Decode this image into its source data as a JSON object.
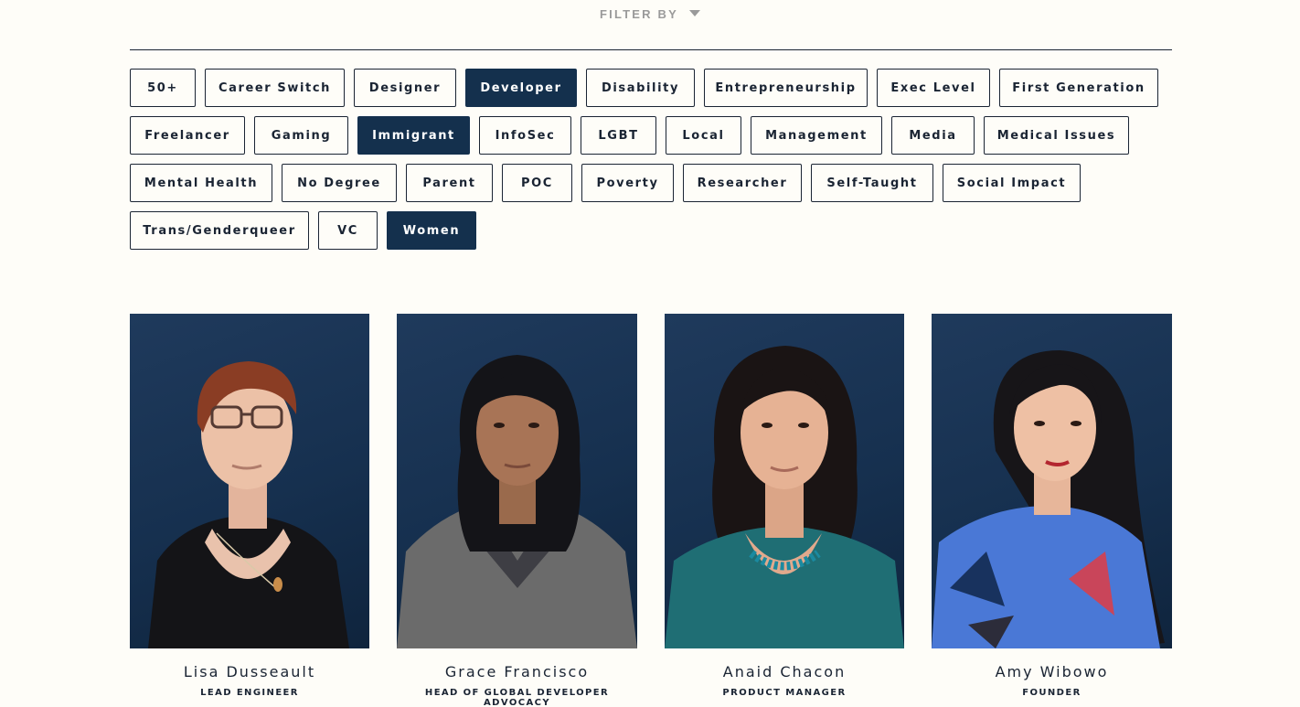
{
  "filter": {
    "label": "FILTER BY"
  },
  "tags": {
    "rows": [
      [
        {
          "label": "50+",
          "active": false
        },
        {
          "label": "Career Switch",
          "active": false
        },
        {
          "label": "Designer",
          "active": false
        },
        {
          "label": "Developer",
          "active": true
        },
        {
          "label": "Disability",
          "active": false
        },
        {
          "label": "Entrepreneurship",
          "active": false
        },
        {
          "label": "Exec Level",
          "active": false
        },
        {
          "label": "First Generation",
          "active": false
        }
      ],
      [
        {
          "label": "Freelancer",
          "active": false
        },
        {
          "label": "Gaming",
          "active": false
        },
        {
          "label": "Immigrant",
          "active": true
        },
        {
          "label": "InfoSec",
          "active": false
        },
        {
          "label": "LGBT",
          "active": false
        },
        {
          "label": "Local",
          "active": false
        },
        {
          "label": "Management",
          "active": false
        },
        {
          "label": "Media",
          "active": false
        },
        {
          "label": "Medical Issues",
          "active": false
        }
      ],
      [
        {
          "label": "Mental Health",
          "active": false
        },
        {
          "label": "No Degree",
          "active": false
        },
        {
          "label": "Parent",
          "active": false
        },
        {
          "label": "POC",
          "active": false
        },
        {
          "label": "Poverty",
          "active": false
        },
        {
          "label": "Researcher",
          "active": false
        },
        {
          "label": "Self-Taught",
          "active": false
        },
        {
          "label": "Social Impact",
          "active": false
        }
      ],
      [
        {
          "label": "Trans/Genderqueer",
          "active": false
        },
        {
          "label": "VC",
          "active": false
        },
        {
          "label": "Women",
          "active": true
        }
      ]
    ]
  },
  "people": [
    {
      "name": "Lisa Dusseault",
      "role": "LEAD ENGINEER"
    },
    {
      "name": "Grace Francisco",
      "role": "HEAD OF GLOBAL DEVELOPER ADVOCACY"
    },
    {
      "name": "Anaid Chacon",
      "role": "PRODUCT MANAGER"
    },
    {
      "name": "Amy Wibowo",
      "role": "FOUNDER"
    }
  ],
  "colors": {
    "background": "#fefdf8",
    "accent": "#14304d",
    "text": "#1a2433",
    "muted": "#9a9a9a"
  },
  "icons": {
    "filter_toggle": "caret-down-icon"
  }
}
